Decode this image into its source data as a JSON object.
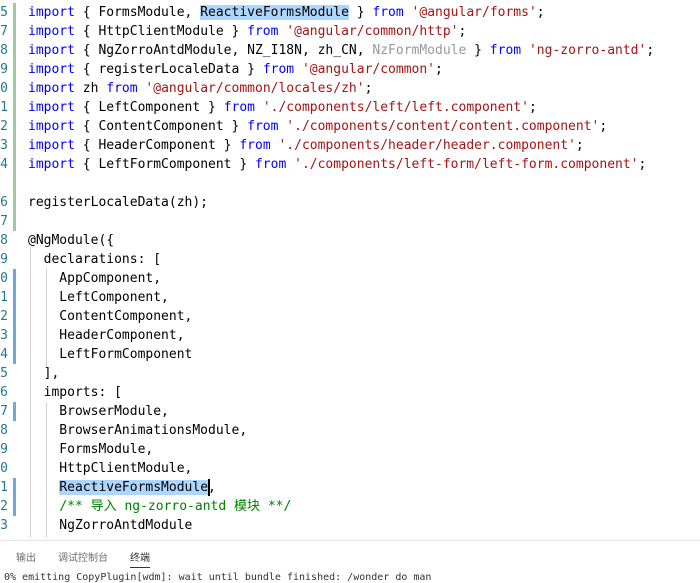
{
  "editor": {
    "lines": [
      {
        "num": "5",
        "git": "green",
        "tokens": [
          {
            "t": "import",
            "c": "kw"
          },
          {
            "t": " { FormsModule, "
          },
          {
            "t": "ReactiveFormsModule",
            "c": "sel"
          },
          {
            "t": " } "
          },
          {
            "t": "from",
            "c": "kw"
          },
          {
            "t": " "
          },
          {
            "t": "'@angular/forms'",
            "c": "str"
          },
          {
            "t": ";"
          }
        ]
      },
      {
        "num": "7",
        "git": "green",
        "tokens": [
          {
            "t": "import",
            "c": "kw"
          },
          {
            "t": " { HttpClientModule } "
          },
          {
            "t": "from",
            "c": "kw"
          },
          {
            "t": " "
          },
          {
            "t": "'@angular/common/http'",
            "c": "str"
          },
          {
            "t": ";"
          }
        ]
      },
      {
        "num": "8",
        "git": "green",
        "tokens": [
          {
            "t": "import",
            "c": "kw"
          },
          {
            "t": " { NgZorroAntdModule, NZ_I18N, zh_CN, "
          },
          {
            "t": "NzFormModule",
            "c": "dim"
          },
          {
            "t": " } "
          },
          {
            "t": "from",
            "c": "kw"
          },
          {
            "t": " "
          },
          {
            "t": "'ng-zorro-antd'",
            "c": "str"
          },
          {
            "t": ";"
          }
        ]
      },
      {
        "num": "9",
        "git": "green",
        "tokens": [
          {
            "t": "import",
            "c": "kw"
          },
          {
            "t": " { registerLocaleData } "
          },
          {
            "t": "from",
            "c": "kw"
          },
          {
            "t": " "
          },
          {
            "t": "'@angular/common'",
            "c": "str"
          },
          {
            "t": ";"
          }
        ]
      },
      {
        "num": "0",
        "git": "green",
        "tokens": [
          {
            "t": "import",
            "c": "kw"
          },
          {
            "t": " zh "
          },
          {
            "t": "from",
            "c": "kw"
          },
          {
            "t": " "
          },
          {
            "t": "'@angular/common/locales/zh'",
            "c": "str"
          },
          {
            "t": ";"
          }
        ]
      },
      {
        "num": "1",
        "git": "green",
        "tokens": [
          {
            "t": "import",
            "c": "kw"
          },
          {
            "t": " { LeftComponent } "
          },
          {
            "t": "from",
            "c": "kw"
          },
          {
            "t": " "
          },
          {
            "t": "'./components/left/left.component'",
            "c": "str"
          },
          {
            "t": ";"
          }
        ]
      },
      {
        "num": "2",
        "git": "green",
        "tokens": [
          {
            "t": "import",
            "c": "kw"
          },
          {
            "t": " { ContentComponent } "
          },
          {
            "t": "from",
            "c": "kw"
          },
          {
            "t": " "
          },
          {
            "t": "'./components/content/content.component'",
            "c": "str"
          },
          {
            "t": ";"
          }
        ]
      },
      {
        "num": "3",
        "git": "green",
        "tokens": [
          {
            "t": "import",
            "c": "kw"
          },
          {
            "t": " { HeaderComponent } "
          },
          {
            "t": "from",
            "c": "kw"
          },
          {
            "t": " "
          },
          {
            "t": "'./components/header/header.component'",
            "c": "str"
          },
          {
            "t": ";"
          }
        ]
      },
      {
        "num": "4",
        "git": "green",
        "tokens": [
          {
            "t": "import",
            "c": "kw"
          },
          {
            "t": " { LeftFormComponent } "
          },
          {
            "t": "from",
            "c": "kw"
          },
          {
            "t": " "
          },
          {
            "t": "'./components/left-form/left-form.component'",
            "c": "str"
          },
          {
            "t": ";"
          }
        ]
      },
      {
        "num": "",
        "git": "green",
        "tokens": []
      },
      {
        "num": "6",
        "git": "green",
        "tokens": [
          {
            "t": "registerLocaleData(zh);"
          }
        ]
      },
      {
        "num": "7",
        "git": "green",
        "tokens": []
      },
      {
        "num": "8",
        "git": "",
        "tokens": [
          {
            "t": "@NgModule({"
          }
        ]
      },
      {
        "num": "9",
        "git": "",
        "tokens": [
          {
            "t": "  declarations: ["
          }
        ]
      },
      {
        "num": "0",
        "git": "blue",
        "tokens": [
          {
            "t": "    AppComponent,"
          }
        ]
      },
      {
        "num": "1",
        "git": "blue",
        "tokens": [
          {
            "t": "    LeftComponent,"
          }
        ]
      },
      {
        "num": "2",
        "git": "blue",
        "tokens": [
          {
            "t": "    ContentComponent,"
          }
        ]
      },
      {
        "num": "3",
        "git": "blue",
        "tokens": [
          {
            "t": "    HeaderComponent,"
          }
        ]
      },
      {
        "num": "4",
        "git": "blue",
        "tokens": [
          {
            "t": "    LeftFormComponent"
          }
        ]
      },
      {
        "num": "5",
        "git": "",
        "tokens": [
          {
            "t": "  ],"
          }
        ]
      },
      {
        "num": "6",
        "git": "",
        "tokens": [
          {
            "t": "  imports: ["
          }
        ]
      },
      {
        "num": "7",
        "git": "blue",
        "tokens": [
          {
            "t": "    BrowserModule,"
          }
        ]
      },
      {
        "num": "8",
        "git": "",
        "tokens": [
          {
            "t": "    BrowserAnimationsModule,"
          }
        ]
      },
      {
        "num": "9",
        "git": "",
        "tokens": [
          {
            "t": "    FormsModule,"
          }
        ]
      },
      {
        "num": "0",
        "git": "",
        "tokens": [
          {
            "t": "    HttpClientModule,"
          }
        ]
      },
      {
        "num": "1",
        "git": "blue",
        "tokens": [
          {
            "t": "    "
          },
          {
            "t": "ReactiveFormsModule",
            "c": "sel"
          },
          {
            "t": ","
          }
        ]
      },
      {
        "num": "2",
        "git": "blue",
        "tokens": [
          {
            "t": "    "
          },
          {
            "t": "/** 导入 ng-zorro-antd 模块 **/",
            "c": "cmt"
          }
        ]
      },
      {
        "num": "3",
        "git": "",
        "tokens": [
          {
            "t": "    NgZorroAntdModule"
          }
        ]
      }
    ]
  },
  "panel": {
    "tabs": [
      {
        "label": "输出",
        "active": false
      },
      {
        "label": "调试控制台",
        "active": false
      },
      {
        "label": "终端",
        "active": true
      }
    ],
    "terminal_text": "0% emitting CopyPlugin[wdm]: wait until bundle finished: /wonder do man"
  },
  "colors": {
    "keyword": "#0000ff",
    "string": "#a31515",
    "comment": "#008000",
    "selection": "#add6ff",
    "line_number": "#237893",
    "git_added": "#9ccc9c",
    "git_modified": "#6fa8dc"
  }
}
